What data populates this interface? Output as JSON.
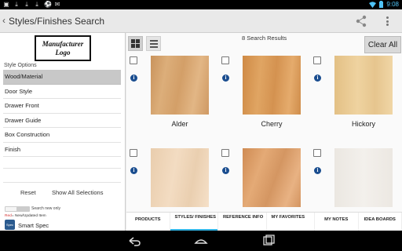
{
  "status_bar": {
    "time": "9:08"
  },
  "action_bar": {
    "title": "Styles/Finishes Search"
  },
  "left_panel": {
    "logo_text": "Manufacturer Logo",
    "section_label": "Style Options",
    "options": [
      {
        "label": "Wood/Material",
        "selected": true
      },
      {
        "label": "Door Style",
        "selected": false
      },
      {
        "label": "Drawer Front",
        "selected": false
      },
      {
        "label": "Drawer Guide",
        "selected": false
      },
      {
        "label": "Box Construction",
        "selected": false
      },
      {
        "label": "Finish",
        "selected": false
      }
    ],
    "reset_label": "Reset",
    "show_all_label": "Show All Selections",
    "search_new_label": "Search new only",
    "legend_red": "Red",
    "legend_rest": "= New/Updated Item",
    "spec_logo": "Spec",
    "smart_spec_label": "Smart Spec"
  },
  "results": {
    "count_text": "8 Search Results",
    "clear_all_label": "Clear All",
    "items": [
      {
        "name": "Alder",
        "color": "#d8a873"
      },
      {
        "name": "Cherry",
        "color": "#d89a55"
      },
      {
        "name": "Hickory",
        "color": "#e8c88e"
      },
      {
        "name": "",
        "color": "#eed3b6"
      },
      {
        "name": "",
        "color": "#d89a63"
      },
      {
        "name": "",
        "color": "#eeebe6"
      }
    ]
  },
  "tabs": [
    {
      "label": "PRODUCTS",
      "active": false
    },
    {
      "label": "STYLES/ FINISHES",
      "active": true
    },
    {
      "label": "REFERENCE INFO",
      "active": false
    },
    {
      "label": "MY FAVORITES",
      "active": false
    },
    {
      "label": "MY NOTES",
      "active": false
    },
    {
      "label": "IDEA BOARDS",
      "active": false
    }
  ],
  "colors": {
    "accent": "#33b5e5",
    "info": "#1a4d8f"
  }
}
